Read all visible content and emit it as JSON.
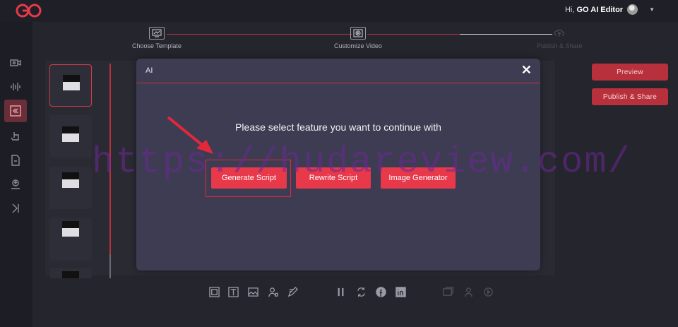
{
  "header": {
    "user_greeting": "Hi,",
    "user_name": "GO AI Editor",
    "logo_icon": "go-logo-icon",
    "brand_color": "#e8394a"
  },
  "stepper": {
    "steps": [
      {
        "label": "Choose Template",
        "icon": "template-icon"
      },
      {
        "label": "Customize Video",
        "icon": "video-icon"
      },
      {
        "label": "Publish & Share",
        "icon": "cloud-upload-icon"
      }
    ]
  },
  "sidebar": {
    "icons": [
      "video-camera-icon",
      "audio-wave-icon",
      "collapse-icon",
      "hand-pointer-icon",
      "document-icon",
      "upload-icon",
      "skip-icon"
    ]
  },
  "actions": {
    "preview_label": "Preview",
    "publish_label": "Publish & Share"
  },
  "toolbar": {
    "icons": [
      "ai-icon",
      "text-icon",
      "image-icon",
      "avatar-icon",
      "edit-icon",
      "pause-icon",
      "loop-icon",
      "facebook-icon",
      "linkedin-icon",
      "gallery-icon",
      "person-icon",
      "play-circle-icon"
    ]
  },
  "modal": {
    "title": "AI",
    "message": "Please select feature you want to continue with",
    "buttons": {
      "generate": "Generate Script",
      "rewrite": "Rewrite Script",
      "image": "Image Generator"
    },
    "close_icon": "close-icon"
  },
  "watermark": "https://hudareview.com/"
}
